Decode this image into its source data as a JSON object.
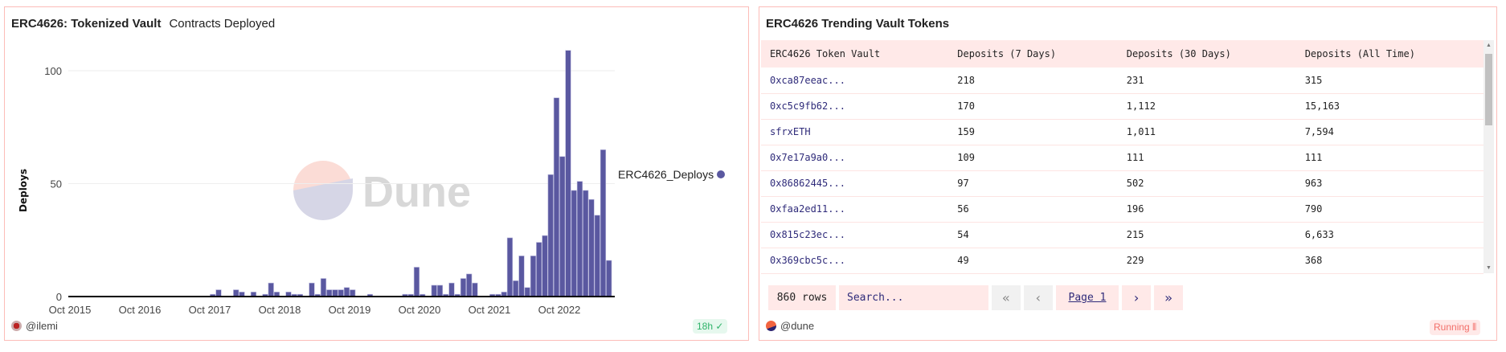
{
  "chart_panel": {
    "title": "ERC4626: Tokenized Vault",
    "subtitle": "Contracts Deployed",
    "author": "@ilemi",
    "age_badge": "18h",
    "watermark": "Dune"
  },
  "chart_data": {
    "type": "bar",
    "title": "ERC4626: Tokenized Vault",
    "subtitle": "Contracts Deployed",
    "xlabel": "",
    "ylabel": "Deploys",
    "ylim": [
      0,
      115
    ],
    "yticks": [
      0,
      50,
      100
    ],
    "xrange": [
      "2015-10",
      "2023-06"
    ],
    "xticks": [
      "Oct 2015",
      "Oct 2016",
      "Oct 2017",
      "Oct 2018",
      "Oct 2019",
      "Oct 2020",
      "Oct 2021",
      "Oct 2022"
    ],
    "grid": true,
    "legend_position": "right",
    "series": [
      {
        "name": "ERC4626_Deploys",
        "color": "#5a58a0",
        "start": "2017-10",
        "values": [
          1,
          3,
          0,
          0,
          3,
          2,
          0,
          2,
          0,
          1,
          6,
          2,
          0,
          2,
          1,
          1,
          0,
          6,
          1,
          8,
          3,
          3,
          3,
          4,
          3,
          0,
          0,
          1,
          0,
          0,
          0,
          0,
          0,
          1,
          1,
          13,
          1,
          0,
          5,
          5,
          1,
          6,
          1,
          8,
          10,
          6,
          0,
          0,
          1,
          1,
          2,
          26,
          7,
          18,
          4,
          18,
          24,
          27,
          54,
          88,
          62,
          109,
          47,
          51,
          47,
          43,
          36,
          65,
          16
        ]
      }
    ]
  },
  "table_panel": {
    "title": "ERC4626 Trending Vault Tokens",
    "columns": [
      "ERC4626 Token Vault",
      "Deposits (7 Days)",
      "Deposits (30 Days)",
      "Deposits (All Time)"
    ],
    "rows": [
      [
        "0xca87eeac...",
        "218",
        "231",
        "315"
      ],
      [
        "0xc5c9fb62...",
        "170",
        "1,112",
        "15,163"
      ],
      [
        "sfrxETH",
        "159",
        "1,011",
        "7,594"
      ],
      [
        "0x7e17a9a0...",
        "109",
        "111",
        "111"
      ],
      [
        "0x86862445...",
        "97",
        "502",
        "963"
      ],
      [
        "0xfaa2ed11...",
        "56",
        "196",
        "790"
      ],
      [
        "0x815c23ec...",
        "54",
        "215",
        "6,633"
      ],
      [
        "0x369cbc5c...",
        "49",
        "229",
        "368"
      ]
    ],
    "row_count": "860 rows",
    "search_placeholder": "Search...",
    "page_label": "Page 1",
    "author": "@dune",
    "status": "Running"
  }
}
